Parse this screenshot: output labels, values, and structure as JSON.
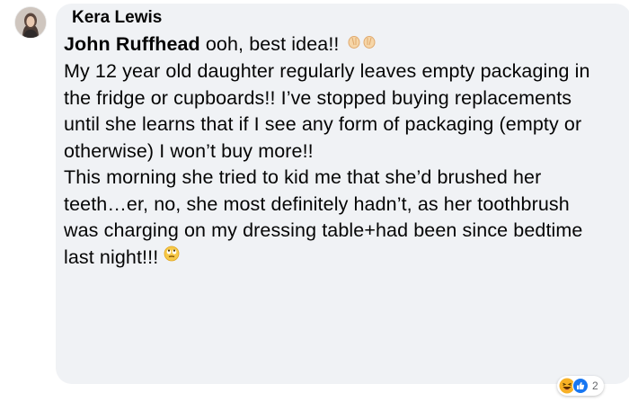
{
  "comment": {
    "author": "Kera Lewis",
    "mention": "John Ruffhead",
    "first_line_rest": " ooh, best idea!!",
    "paragraph_1": "My 12 year old daughter regularly leaves empty packaging in the fridge or cupboards!! I’ve stopped buying replacements until she learns that if I see any form of packaging (empty or otherwise) I won’t buy more!!",
    "paragraph_2": "This morning she tried to kid me that she’d brushed her teeth…er, no, she most definitely hadn’t, as her toothbrush was charging on my dressing table+had been since bedtime last night!!!",
    "inline_emojis": [
      "clapping-hands-icon",
      "rolling-eyes-icon"
    ]
  },
  "reactions": {
    "icons": [
      "haha-icon",
      "like-icon"
    ],
    "count": "2"
  },
  "colors": {
    "bubble": "#f0f2f5",
    "text": "#050505",
    "like_blue": "#1877f2",
    "haha_yellow": "#f7b125"
  }
}
